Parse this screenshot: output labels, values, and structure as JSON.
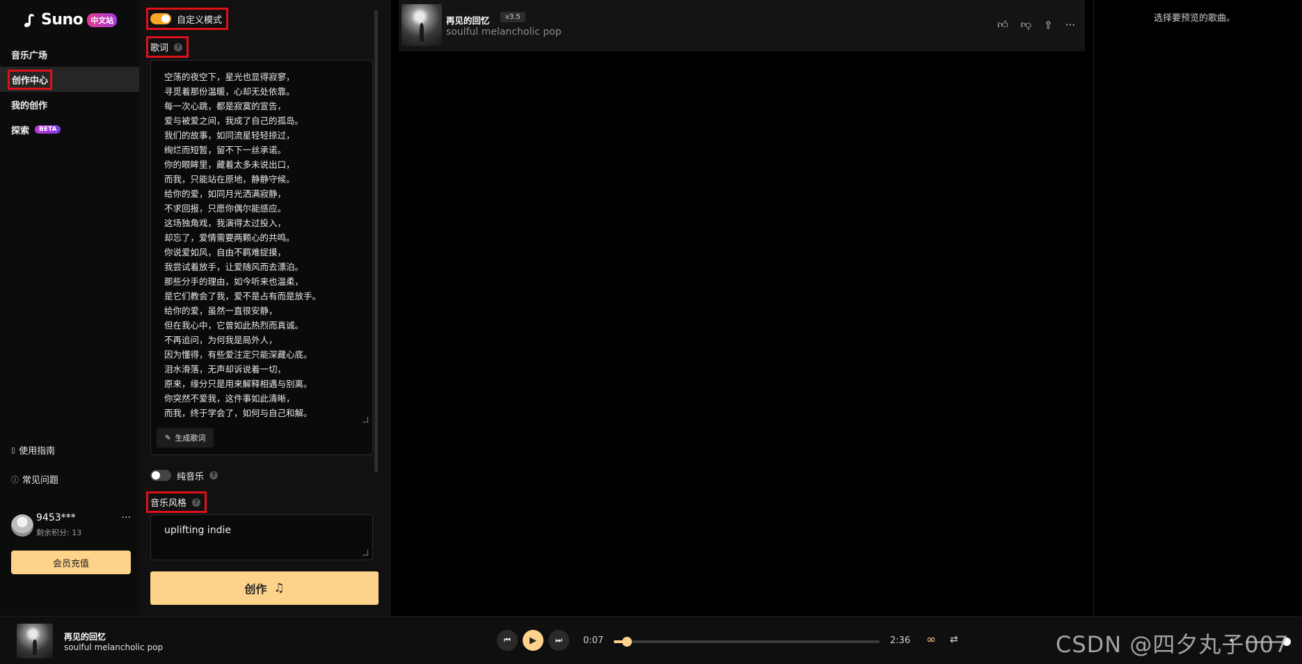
{
  "brand": {
    "name": "Suno",
    "badge": "中文站"
  },
  "nav": [
    {
      "label": "音乐广场"
    },
    {
      "label": "创作中心"
    },
    {
      "label": "我的创作"
    },
    {
      "label": "探索",
      "badge": "BETA"
    }
  ],
  "help": {
    "guide": "使用指南",
    "faq": "常见问题"
  },
  "user": {
    "name": "9453***",
    "credits": "剩余积分: 13",
    "more": "···"
  },
  "recharge_label": "会员充值",
  "create_panel": {
    "custom_mode_label": "自定义模式",
    "custom_mode_on": true,
    "lyrics_label": "歌词",
    "lyrics": [
      "空荡的夜空下，星光也显得寂寥，",
      "寻觅着那份温暖，心却无处依靠。",
      "每一次心跳，都是寂寞的宣告，",
      "爱与被爱之间，我成了自己的孤岛。",
      "我们的故事，如同流星轻轻掠过，",
      "绚烂而短暂，留不下一丝承诺。",
      "你的眼眸里，藏着太多未说出口，",
      "而我，只能站在原地，静静守候。",
      "给你的爱，如同月光洒满寂静，",
      "不求回报，只愿你偶尔能感应。",
      "这场独角戏，我演得太过投入，",
      "却忘了，爱情需要两颗心的共鸣。",
      "你说爱如风，自由不羁难捉摸，",
      "我尝试着放手，让爱随风而去漂泊。",
      "那些分手的理由，如今听来也温柔，",
      "是它们教会了我，爱不是占有而是放手。",
      "给你的爱，虽然一直很安静，",
      "但在我心中，它曾如此热烈而真诚。",
      "不再追问，为何我是局外人，",
      "因为懂得，有些爱注定只能深藏心底。",
      "泪水滑落，无声却诉说着一切，",
      "原来，缘分只是用来解释相遇与别离。",
      "你突然不爱我，这件事如此清晰，",
      "而我，终于学会了，如何与自己和解。"
    ],
    "generate_lyrics_label": "生成歌词",
    "instrumental_label": "纯音乐",
    "instrumental_on": false,
    "style_label": "音乐风格",
    "style_value": "uplifting indie",
    "create_label": "创作"
  },
  "song": {
    "title": "再见的回忆",
    "version": "v3.5",
    "style": "soulful melancholic pop"
  },
  "preview_hint": "选择要预览的歌曲。",
  "player": {
    "title": "再见的回忆",
    "style": "soulful melancholic pop",
    "current_time": "0:07",
    "duration": "2:36",
    "progress_fraction": 0.05,
    "volume_fraction": 0.95
  },
  "watermark": "CSDN @四夕丸子007",
  "colors": {
    "accent": "#fdd28a",
    "toggle_on": "#f5a623",
    "highlight_box": "#e0101a"
  }
}
